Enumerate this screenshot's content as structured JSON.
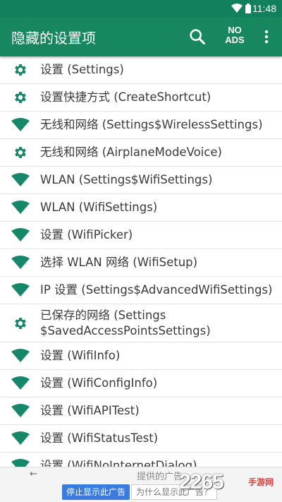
{
  "status_bar": {
    "time": "11:48"
  },
  "app_bar": {
    "title": "隐藏的设置项",
    "no_ads_line1": "NO",
    "no_ads_line2": "ADS"
  },
  "colors": {
    "primary": "#16875f",
    "status": "#12805c",
    "icon": "#17876a"
  },
  "items": [
    {
      "icon": "gear-icon",
      "label": "设置 (Settings)"
    },
    {
      "icon": "gear-icon",
      "label": "设置快捷方式 (CreateShortcut)"
    },
    {
      "icon": "wifi-icon",
      "label": "无线和网络 (Settings$WirelessSettings)"
    },
    {
      "icon": "gear-icon",
      "label": "无线和网络 (AirplaneModeVoice)"
    },
    {
      "icon": "wifi-icon",
      "label": "WLAN (Settings$WifiSettings)"
    },
    {
      "icon": "wifi-icon",
      "label": "WLAN (WifiSettings)"
    },
    {
      "icon": "wifi-icon",
      "label": "设置 (WifiPicker)"
    },
    {
      "icon": "wifi-icon",
      "label": "选择 WLAN 网络 (WifiSetup)"
    },
    {
      "icon": "wifi-icon",
      "label": "IP 设置 (Settings$AdvancedWifiSettings)"
    },
    {
      "icon": "gear-icon",
      "label": "已保存的网络 (Settings $SavedAccessPointsSettings)"
    },
    {
      "icon": "wifi-icon",
      "label": "设置 (WifiInfo)"
    },
    {
      "icon": "wifi-icon",
      "label": "设置 (WifiConfigInfo)"
    },
    {
      "icon": "wifi-icon",
      "label": "设置 (WifiAPITest)"
    },
    {
      "icon": "wifi-icon",
      "label": "设置 (WifiStatusTest)"
    },
    {
      "icon": "wifi-icon",
      "label": "设置 (WifiNoInternetDialog)"
    }
  ],
  "ad_bar": {
    "caption": "提供的广告",
    "stop_label": "停止显示此广告",
    "why_label": "为什么显示此广告？",
    "brand": "2265",
    "brand_sub": "手游网"
  }
}
